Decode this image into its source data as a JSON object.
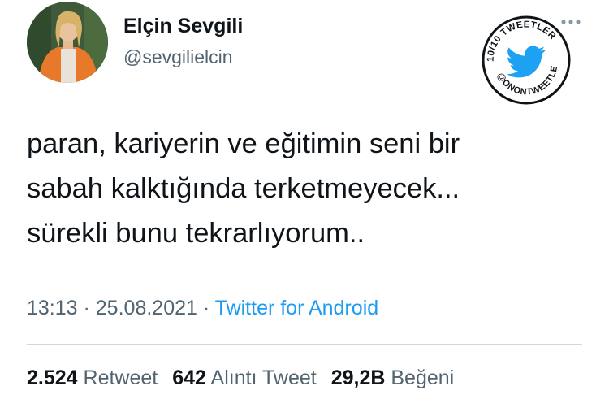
{
  "author": {
    "display_name": "Elçin Sevgili",
    "handle": "@sevgilielcin",
    "avatar_icon": "profile-photo"
  },
  "watermark": {
    "top_text": "10/10 TWEETLER",
    "bottom_text": "@ONONTWEETLER",
    "icon": "twitter-bird-icon",
    "color": "#1da1f2"
  },
  "tweet": {
    "lines": [
      "paran, kariyerin ve eğitimin seni bir",
      "sabah kalktığında terketmeyecek...",
      "sürekli bunu tekrarlıyorum.."
    ]
  },
  "meta": {
    "time": "13:13",
    "separator": " · ",
    "date": "25.08.2021",
    "source": "Twitter for Android"
  },
  "stats": {
    "retweets": {
      "count": "2.524",
      "label": "Retweet"
    },
    "quotes": {
      "count": "642",
      "label": "Alıntı Tweet"
    },
    "likes": {
      "count": "29,2B",
      "label": "Beğeni"
    }
  },
  "colors": {
    "text": "#0f1419",
    "secondary": "#536471",
    "accent": "#1d9bf0",
    "divider": "#cfd9de"
  }
}
